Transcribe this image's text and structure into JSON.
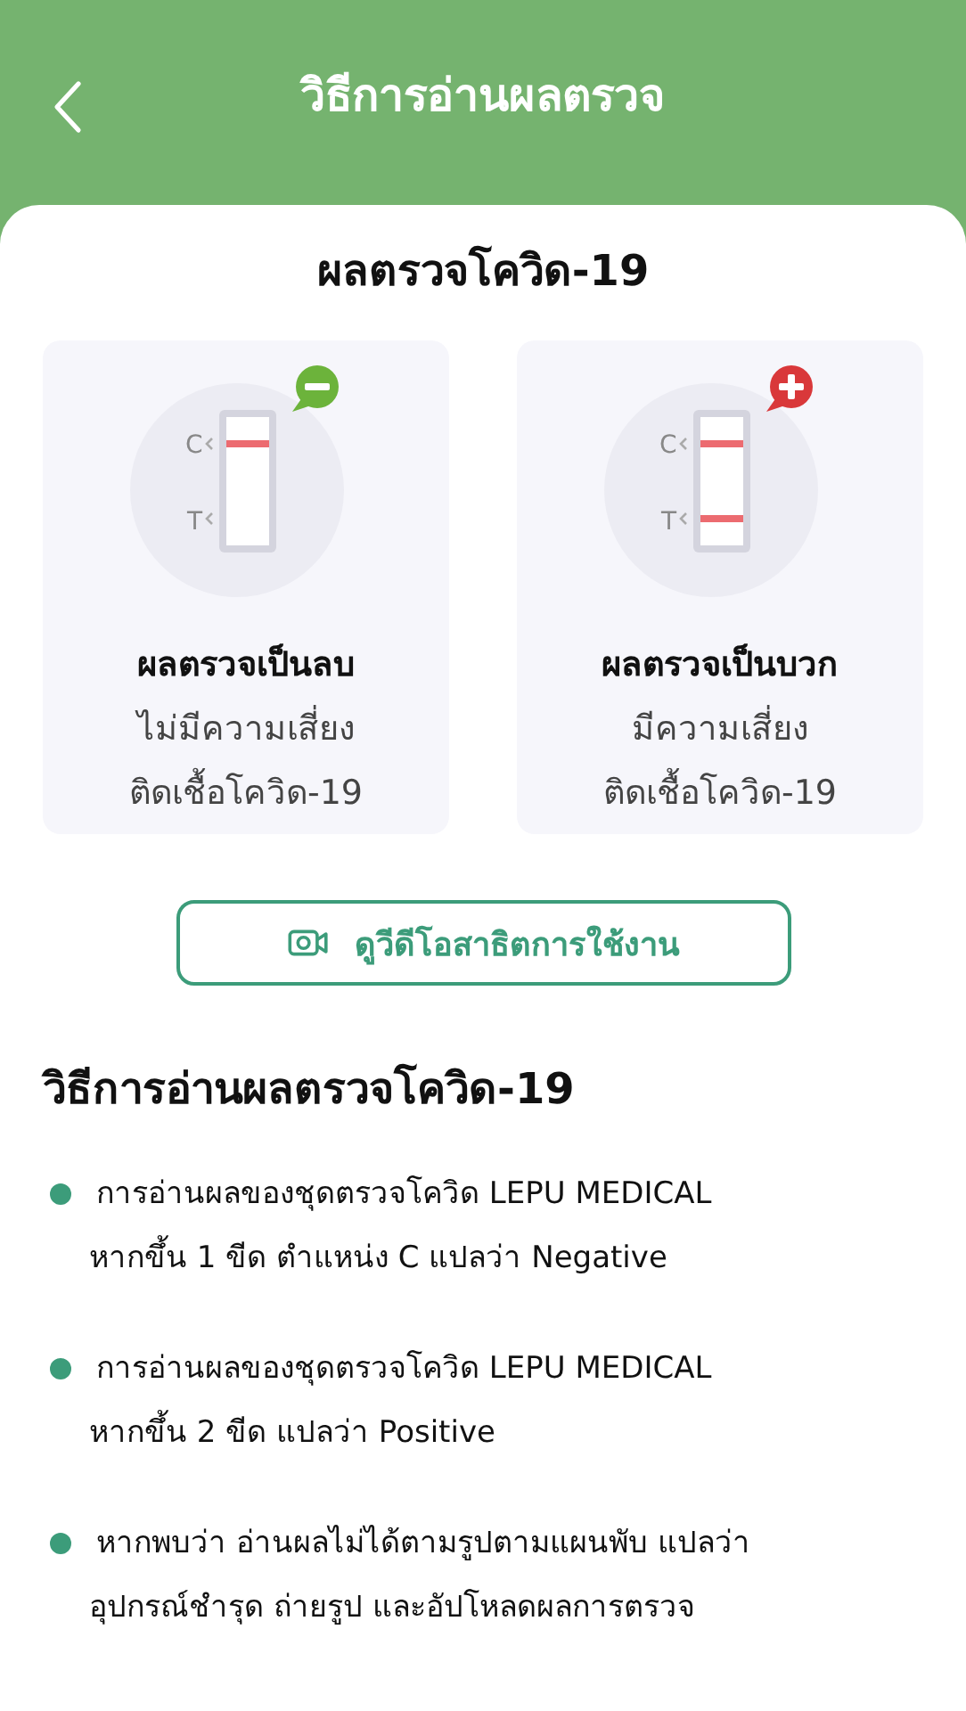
{
  "header": {
    "title": "วิธีการอ่านผลตรวจ"
  },
  "title": "ผลตรวจโควิด-19",
  "results": [
    {
      "kind": "negative",
      "test_line": false,
      "control_label": "C",
      "test_label": "T",
      "heading": "ผลตรวจเป็นลบ",
      "lines": [
        "ไม่มีความเสี่ยง",
        "ติดเชื้อโควิด-19"
      ]
    },
    {
      "kind": "positive",
      "test_line": true,
      "control_label": "C",
      "test_label": "T",
      "heading": "ผลตรวจเป็นบวก",
      "lines": [
        "มีความเสี่ยง",
        "ติดเชื้อโควิด-19"
      ]
    }
  ],
  "video_button": {
    "label": "ดูวีดีโอสาธิตการใช้งาน"
  },
  "section_title": "วิธีการอ่านผลตรวจโควิด-19",
  "steps": [
    {
      "lines": [
        "การอ่านผลของชุดตรวจโควิด LEPU MEDICAL",
        "หากขึ้น 1 ขีด ตำแหน่ง C แปลว่า Negative"
      ]
    },
    {
      "lines": [
        "การอ่านผลของชุดตรวจโควิด LEPU MEDICAL",
        "หากขึ้น 2 ขีด แปลว่า Positive"
      ]
    },
    {
      "lines": [
        "หากพบว่า อ่านผลไม่ได้ตามรูปตามแผนพับ แปลว่า",
        "อุปกรณ์ชำรุด ถ่ายรูป และอัปโหลดผลการตรวจ"
      ]
    }
  ]
}
